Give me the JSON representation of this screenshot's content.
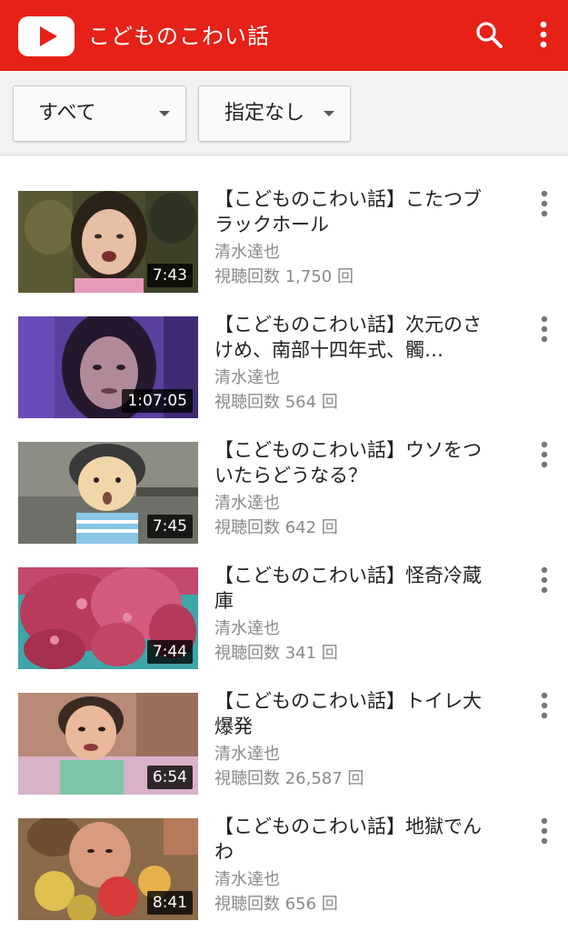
{
  "header": {
    "title": "こどものこわい話",
    "brand_color": "#e62117",
    "logo_icon": "youtube-play-icon",
    "search_icon": "search-icon",
    "menu_icon": "more-vert-icon"
  },
  "filters": {
    "type_label": "すべて",
    "sort_label": "指定なし"
  },
  "videos": [
    {
      "title": "【こどものこわい話】こたつブラックホール",
      "channel": "清水達也",
      "views": "視聴回数 1,750 回",
      "duration": "7:43"
    },
    {
      "title": "【こどものこわい話】次元のさけめ、南部十四年式、髑…",
      "channel": "清水達也",
      "views": "視聴回数 564 回",
      "duration": "1:07:05"
    },
    {
      "title": "【こどものこわい話】ウソをついたらどうなる？",
      "channel": "清水達也",
      "views": "視聴回数 642 回",
      "duration": "7:45"
    },
    {
      "title": "【こどものこわい話】怪奇冷蔵庫",
      "channel": "清水達也",
      "views": "視聴回数 341 回",
      "duration": "7:44"
    },
    {
      "title": "【こどものこわい話】トイレ大爆発",
      "channel": "清水達也",
      "views": "視聴回数 26,587 回",
      "duration": "6:54"
    },
    {
      "title": "【こどものこわい話】地獄でんわ",
      "channel": "清水達也",
      "views": "視聴回数 656 回",
      "duration": "8:41"
    }
  ]
}
